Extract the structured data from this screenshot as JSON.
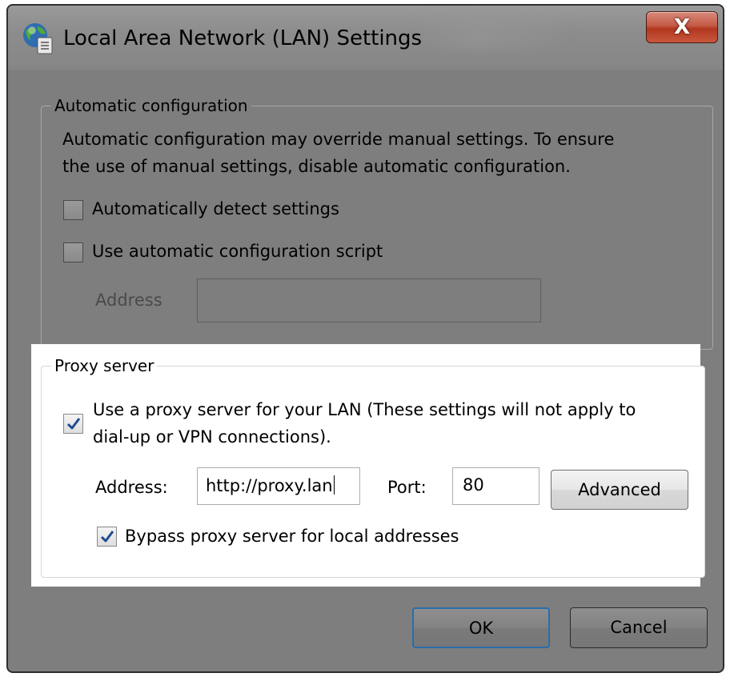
{
  "window": {
    "title": "Local Area Network (LAN) Settings",
    "close_label": "X",
    "icons": {
      "title": "globe-network-icon",
      "close": "close-icon"
    }
  },
  "automatic_configuration": {
    "group_label": "Automatic configuration",
    "description_line1": "Automatic configuration may override manual settings.  To ensure",
    "description_line2": "the use of manual settings, disable automatic configuration.",
    "auto_detect": {
      "label": "Automatically detect settings",
      "checked": false
    },
    "auto_script": {
      "label": "Use automatic configuration script",
      "checked": false
    },
    "address_label": "Address",
    "address_value": ""
  },
  "proxy_server": {
    "group_label": "Proxy server",
    "use_proxy": {
      "label_line1": "Use a proxy server for your LAN (These settings will not apply to",
      "label_line2": "dial-up or VPN connections).",
      "checked": true
    },
    "address_label": "Address:",
    "address_value": "http://proxy.lan",
    "port_label": "Port:",
    "port_value": "80",
    "advanced_label": "Advanced",
    "bypass_local": {
      "label": "Bypass proxy server for local addresses",
      "checked": true
    }
  },
  "buttons": {
    "ok": "OK",
    "cancel": "Cancel"
  },
  "colors": {
    "checkmark": "#1f4c8f",
    "close_button": "#c35a45",
    "ok_border": "#2a6ea8"
  }
}
